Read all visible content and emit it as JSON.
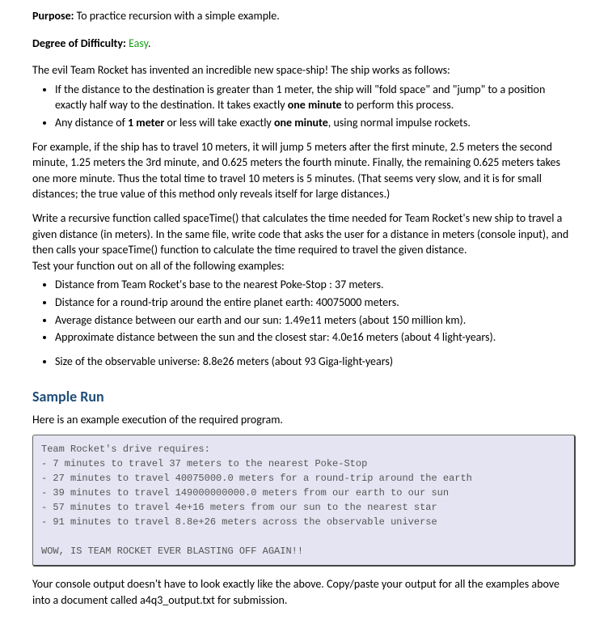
{
  "purpose_label": "Purpose:",
  "purpose_text": " To practice recursion with a simple example.",
  "difficulty_label": "Degree of Difficulty:",
  "difficulty_value": "Easy",
  "intro": "The evil Team Rocket has invented an incredible new space-ship! The ship works as follows:",
  "rules": [
    "If the distance to the destination is greater than 1 meter, the ship will \"fold space\" and \"jump\" to a position exactly half way to the destination. It takes exactly one minute to perform this process.",
    "Any distance of 1 meter or less will take exactly one minute, using normal impulse rockets."
  ],
  "example_para": "For example, if the ship has to travel 10 meters, it will jump 5 meters after the first minute, 2.5 meters the second minute, 1.25 meters the 3rd minute, and 0.625 meters the fourth minute. Finally, the remaining 0.625 meters takes one more minute. Thus the total time to travel 10 meters is 5 minutes. (That seems very slow, and it is for small distances; the true value of this method only reveals itself for large distances.)",
  "task_para": "Write a recursive function called spaceTime() that calculates the time needed for Team Rocket's new ship to travel a given distance (in meters). In the same file, write code that asks the user for a distance in meters (console input), and then calls your spaceTime() function to calculate the time required to travel the given distance.",
  "test_intro": "Test your function out on all of the following examples:",
  "tests": [
    "Distance from Team Rocket's base to the nearest Poke-Stop : 37 meters.",
    "Distance for a round-trip around the entire planet earth: 40075000 meters.",
    "Average distance between our earth and our sun: 1.49e11 meters (about 150 million km).",
    "Approximate distance between the sun and the closest star: 4.0e16 meters (about 4 light-years)."
  ],
  "test_extra": "Size of the observable universe: 8.8e26 meters (about 93 Giga-light-years)",
  "sample_heading": "Sample Run",
  "sample_intro": "Here is an example execution of the required program.",
  "code_output": "Team Rocket's drive requires:\n- 7 minutes to travel 37 meters to the nearest Poke-Stop\n- 27 minutes to travel 40075000.0 meters for a round-trip around the earth\n- 39 minutes to travel 149000000000.0 meters from our earth to our sun\n- 57 minutes to travel 4e+16 meters from our sun to the nearest star\n- 91 minutes to travel 8.8e+26 meters across the observable universe\n\nWOW, IS TEAM ROCKET EVER BLASTING OFF AGAIN!!",
  "closing": "Your console output doesn't have to look exactly like the above. Copy/paste your output for all the examples above into a document called a4q3_output.txt for submission."
}
